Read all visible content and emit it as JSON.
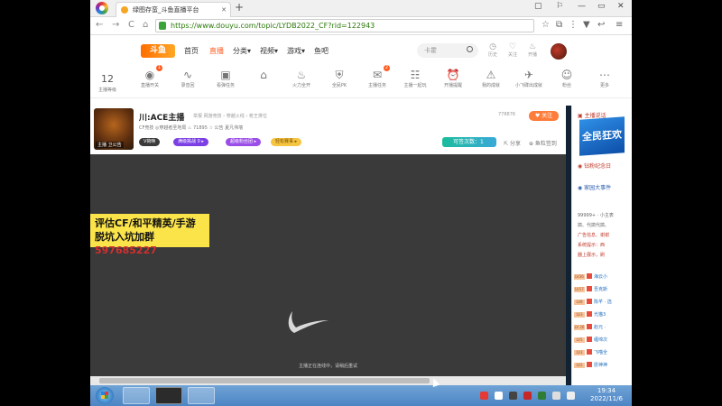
{
  "browser": {
    "tab_title": "绿图存蛮_斗鱼直播平台",
    "new_tab": "+",
    "url": "https://www.douyu.com/topic/LYDB2022_CF?rid=122943",
    "win_controls": [
      "▢",
      "⚐",
      "—",
      "▭",
      "✕"
    ],
    "nav": [
      "←",
      "→",
      "C",
      "⌂"
    ],
    "toolbar": [
      "☆",
      "⧉",
      "⋮",
      "▼",
      "↩",
      "≡"
    ]
  },
  "site": {
    "logo": "斗鱼",
    "nav": [
      "首页",
      "直播",
      "分类▾",
      "视频▾",
      "游戏▾",
      "鱼吧"
    ],
    "search_placeholder": "卡霍",
    "right_icons": [
      {
        "glyph": "◷",
        "label": "历史"
      },
      {
        "glyph": "♡",
        "label": "关注"
      },
      {
        "glyph": "♨",
        "label": "开播"
      }
    ]
  },
  "icon_row": {
    "level_number": "12",
    "level_label": "主播等级",
    "items": [
      {
        "glyph": "◉",
        "label": "直播开关",
        "badge": "1"
      },
      {
        "glyph": "∿",
        "label": "录音回"
      },
      {
        "glyph": "▣",
        "label": "看弹任务"
      },
      {
        "glyph": "⌂",
        "label": ""
      },
      {
        "glyph": "♨",
        "label": "火力全开"
      },
      {
        "glyph": "⛨",
        "label": "全民PK"
      },
      {
        "glyph": "✉",
        "label": "主播任务",
        "badge": "2"
      },
      {
        "glyph": "☷",
        "label": "主播一起玩"
      },
      {
        "glyph": "⏰",
        "label": "开播提醒"
      },
      {
        "glyph": "⚠",
        "label": "我的成就"
      },
      {
        "glyph": "✈",
        "label": "小飞碟出成就"
      },
      {
        "glyph": "☺",
        "label": "粉丝"
      },
      {
        "glyph": "⋯",
        "label": "更多"
      }
    ]
  },
  "room": {
    "title": "川:ACE主播",
    "meta": "举报   网游竞技 › 穿越火线 › 枪王排位",
    "avatar_tag": "主播 卫公告",
    "row2": "CF竞技   ◎穿越者圣地局   ♨ 71895   ☆ 公告   夏凡伟墙",
    "pills": [
      {
        "label": "V荷唤",
        "color": "#3a3a3a"
      },
      {
        "label": "满级挑战  0 ▸",
        "color": "#7b3fe4"
      },
      {
        "label": "超级粉丝团 ▸",
        "color": "#9b4de8"
      },
      {
        "label": "轻松赛事 ▸",
        "color": "#f5c542"
      }
    ],
    "fans": "778876",
    "follow_label": "♥ 关注",
    "shou_label": "可签次数：1",
    "actions": [
      "⇱ 分享",
      "⊕ 鱼粒签到"
    ]
  },
  "video": {
    "ad_line1": "评估CF/和平精英/手游",
    "ad_line2": "脱坑入坑加群",
    "ad_number": "597685227",
    "message": "主播正在连线中，请稍后重试"
  },
  "sidebar": {
    "banner": "全民狂欢",
    "items": [
      {
        "text": "▣ 主播说话",
        "blue": false
      },
      {
        "text": "◉ 钻粉纪念日",
        "blue": false
      },
      {
        "text": "◉ 家园大事件",
        "blue": true
      }
    ],
    "lines": [
      "99999+ · 小主表",
      "搞、代搞代搞、",
      "广告信息、谢谢",
      "系统提示：西",
      "器上展示，刷"
    ],
    "chat": [
      {
        "badge": "LV36",
        "text": "海云小"
      },
      {
        "badge": "LV17",
        "text": "吾克斯"
      },
      {
        "badge": "LV8",
        "text": "陈芊 · 选"
      },
      {
        "badge": "LV3",
        "text": "光猫3"
      },
      {
        "badge": "LV 26",
        "text": "赵元 ·"
      },
      {
        "badge": "LV5",
        "text": "缠绵次"
      },
      {
        "badge": "LV3",
        "text": "飞喵全"
      },
      {
        "badge": "LV2",
        "text": "愿神神"
      }
    ]
  },
  "taskbar": {
    "time": "19:34",
    "date": "2022/11/6"
  }
}
